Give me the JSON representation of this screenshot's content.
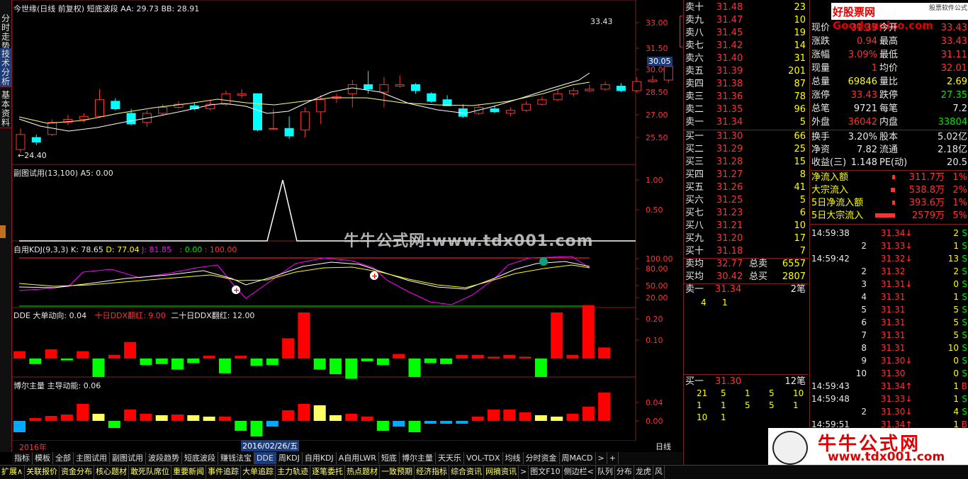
{
  "sidebar": {
    "tabs": [
      "分时走势",
      "技术分析",
      "基本资料"
    ]
  },
  "main_panel": {
    "title": "今世缘(日线 前复权) 短底波段",
    "aa_label": "AA: 29.73",
    "bb_label": "BB: 28.91",
    "high_marker": "33.43",
    "low_marker": "24.40",
    "current_price_tag": "30.05",
    "y_ticks": [
      "33.00",
      "31.50",
      "30.00",
      "28.50",
      "27.00",
      "25.50"
    ]
  },
  "sub1": {
    "title": "副图试用(13,100)  A5: 0.00",
    "y_ticks": [
      "1.00",
      "0.50"
    ]
  },
  "kdj": {
    "title": "自用KDJ(9,3,3)",
    "k": "K: 78.65",
    "d": "D: 77.04",
    "j": "J: 81.85",
    "v1": ": 0.00",
    "v2": ": 100.00",
    "y_ticks": [
      "100.00",
      "80.00",
      "50.00",
      "20.00"
    ]
  },
  "dde": {
    "title": "DDE  大单动向: 0.04",
    "ten": "十日DDX翻红: 9.00",
    "twenty": "二十日DDX翻红: 12.00",
    "y_ticks": [
      "0.20",
      "0.10"
    ]
  },
  "boll": {
    "title": "博尔主量  主导动能: 0.06",
    "y_ticks": [
      "0.04",
      "0.00"
    ]
  },
  "axis": {
    "year": "2016年",
    "date": "2016/02/26/五",
    "period": "日线"
  },
  "watermark": "牛牛公式网:www.tdx001.com",
  "tabs": [
    "指标",
    "模板",
    "全部",
    "主图试用",
    "副图试用",
    "波段趋势",
    "短底波段",
    "赚钱法宝",
    "DDE",
    "周KDJ",
    "自用KDJ",
    "A自用LWR",
    "短底",
    "博尔主量",
    "天天乐",
    "VOL-TDX",
    "均线",
    "分时资金",
    "周MACD",
    ">",
    "+"
  ],
  "bottom_tabs": [
    "扩展∧",
    "关联报价",
    "资金分布",
    "核心题材",
    "敢死队席位",
    "重要新闻",
    "事件追踪",
    "大单追踪",
    "主力轨迹",
    "逐笔委托",
    "热点题材",
    "一致预期",
    "经济指标",
    "综合资讯",
    "网摘资讯",
    ">",
    "图文F10",
    "侧边栏<",
    "队列",
    "分布",
    "龙虎",
    "风"
  ],
  "orderbook": {
    "asks": [
      [
        "卖十",
        "31.48",
        "23"
      ],
      [
        "卖九",
        "31.47",
        "10"
      ],
      [
        "卖八",
        "31.45",
        "19"
      ],
      [
        "卖七",
        "31.42",
        "14"
      ],
      [
        "卖六",
        "31.40",
        "31"
      ],
      [
        "卖五",
        "31.39",
        "201"
      ],
      [
        "卖四",
        "31.38",
        "87"
      ],
      [
        "卖三",
        "31.36",
        "78"
      ],
      [
        "卖二",
        "31.35",
        "96"
      ],
      [
        "卖一",
        "31.34",
        "5"
      ]
    ],
    "bids": [
      [
        "买一",
        "31.30",
        "66"
      ],
      [
        "买二",
        "31.29",
        "25"
      ],
      [
        "买三",
        "31.28",
        "15"
      ],
      [
        "买四",
        "31.27",
        "8"
      ],
      [
        "买五",
        "31.26",
        "41"
      ],
      [
        "买六",
        "31.25",
        "5"
      ],
      [
        "买七",
        "31.23",
        "6"
      ],
      [
        "买八",
        "31.21",
        "10"
      ],
      [
        "买九",
        "31.20",
        "17"
      ],
      [
        "买十",
        "31.18",
        "7"
      ]
    ],
    "avg_ask": [
      "卖均",
      "32.77",
      "总卖",
      "6557"
    ],
    "avg_bid": [
      "买均",
      "30.42",
      "总买",
      "2807"
    ],
    "queue_ask": {
      "label": "卖一",
      "price": "31.34",
      "count": "2笔",
      "items": [
        "4",
        "1"
      ]
    },
    "queue_bid": {
      "label": "买一",
      "price": "31.30",
      "count": "12笔",
      "items": [
        [
          "21",
          "5",
          "1",
          "5",
          "10"
        ],
        [
          "1",
          "1",
          "5",
          "5",
          "1"
        ],
        [
          "10",
          "1"
        ]
      ]
    }
  },
  "quote": {
    "logo": "好股票网Goodgupiao.com",
    "logo_sub": "股票软件公式",
    "rows": [
      [
        "现价",
        "31.33",
        "今开",
        "33.43"
      ],
      [
        "涨跌",
        "0.94",
        "最高",
        "33.43"
      ],
      [
        "涨幅",
        "3.09%",
        "最低",
        "31.11"
      ],
      [
        "现量",
        "1",
        "均价",
        "32.01"
      ],
      [
        "总量",
        "69846",
        "量比",
        "2.69"
      ],
      [
        "涨停",
        "33.43",
        "跌停",
        "27.35"
      ],
      [
        "总笔",
        "9721",
        "每笔",
        "7.2"
      ],
      [
        "外盘",
        "36042",
        "内盘",
        "33804"
      ]
    ],
    "rows2": [
      [
        "换手",
        "3.20%",
        "股本",
        "5.02亿"
      ],
      [
        "净资",
        "7.82",
        "流通",
        "2.18亿"
      ],
      [
        "收益(三)",
        "1.148",
        "PE(动)",
        "20.5"
      ]
    ],
    "flows": [
      [
        "净流入额",
        "311.7万",
        "1%"
      ],
      [
        "大宗流入",
        "538.8万",
        "2%"
      ],
      [
        "5日净流入额",
        "393.6万",
        "1%"
      ],
      [
        "5日大宗流入",
        "2579万",
        "5%"
      ]
    ],
    "ticks": [
      [
        "14:59:38",
        "31.34↓",
        "2",
        "S"
      ],
      [
        "",
        "2",
        "31.33↓",
        "1",
        "S"
      ],
      [
        "14:59:42",
        "31.32↓",
        "13",
        "S"
      ],
      [
        "",
        "2",
        "31.32",
        "2",
        "S"
      ],
      [
        "",
        "3",
        "31.31↓",
        "0",
        "S"
      ],
      [
        "",
        "4",
        "31.31",
        "1",
        "S"
      ],
      [
        "",
        "5",
        "31.31",
        "5",
        "S"
      ],
      [
        "",
        "6",
        "31.31",
        "5",
        "S"
      ],
      [
        "",
        "7",
        "31.31",
        "5",
        "S"
      ],
      [
        "",
        "8",
        "31.31",
        "10",
        "S"
      ],
      [
        "",
        "9",
        "31.30↓",
        "0",
        "S"
      ],
      [
        "",
        "10",
        "31.30",
        "0",
        "S"
      ],
      [
        "14:59:43",
        "31.34↑",
        "1",
        "B"
      ],
      [
        "14:59:48",
        "31.33↓",
        "1",
        "S"
      ],
      [
        "",
        "2",
        "31.30↓",
        "4",
        "S"
      ],
      [
        "14:59:51",
        "31.34↑",
        "1",
        "B"
      ]
    ],
    "ad_title": "牛牛公式网",
    "ad_url": "www.tdx001.com"
  },
  "colors": {
    "up": "#ff3232",
    "down": "#00ffff",
    "ma1": "#ffffff",
    "ma2": "#ffff80",
    "dde_up": "#ff0000",
    "dde_down": "#00ff00",
    "border": "#802020"
  }
}
